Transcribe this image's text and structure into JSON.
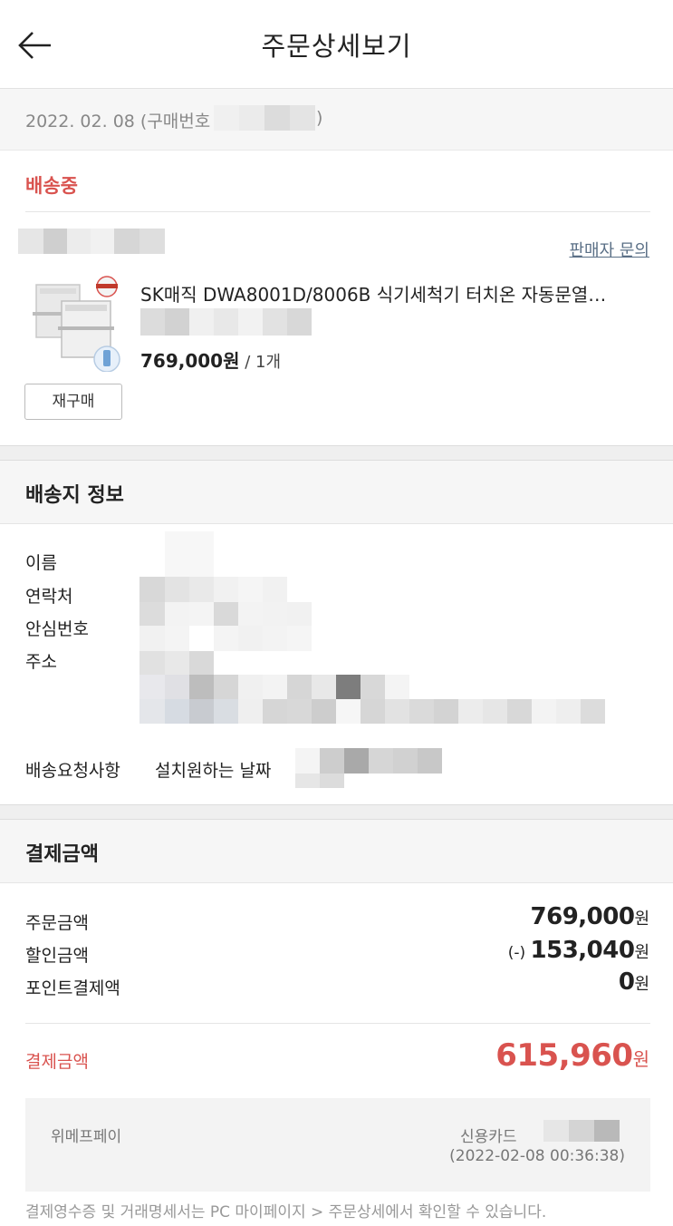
{
  "header": {
    "title": "주문상세보기",
    "back_icon": "arrow-left-icon"
  },
  "order": {
    "date": "2022. 02. 08 (구매번호",
    "date_close": ")"
  },
  "shipment": {
    "status": "배송중",
    "seller_inquiry": "판매자 문의",
    "product": {
      "name": "SK매직 DWA8001D/8006B 식기세척기 터치온 자동문열…",
      "price": "769,000원",
      "qty": " / 1개",
      "rebuy_label": "재구매"
    }
  },
  "delivery": {
    "title": "배송지 정보",
    "labels": {
      "name": "이름",
      "contact": "연락처",
      "safe_number": "안심번호",
      "address": "주소",
      "request": "배송요청사항"
    },
    "request_value": "설치원하는 날짜"
  },
  "payment": {
    "title": "결제금액",
    "rows": [
      {
        "label": "주문금액",
        "prefix": "",
        "amount": "769,000",
        "unit": "원"
      },
      {
        "label": "할인금액",
        "prefix": "(-) ",
        "amount": "153,040",
        "unit": "원"
      },
      {
        "label": "포인트결제액",
        "prefix": "",
        "amount": "0",
        "unit": "원"
      }
    ],
    "total_label": "결제금액",
    "total_amount": "615,960",
    "total_unit": "원",
    "method": {
      "name": "위메프페이",
      "card": "신용카드",
      "time": "(2022-02-08 00:36:38)"
    },
    "footnote": "결제영수증 및 거래명세서는 PC 마이페이지 > 주문상세에서 확인할 수 있습니다."
  },
  "colors": {
    "accent_red": "#d9534f",
    "link": "#5a6f86",
    "section_bg": "#f6f6f6"
  }
}
